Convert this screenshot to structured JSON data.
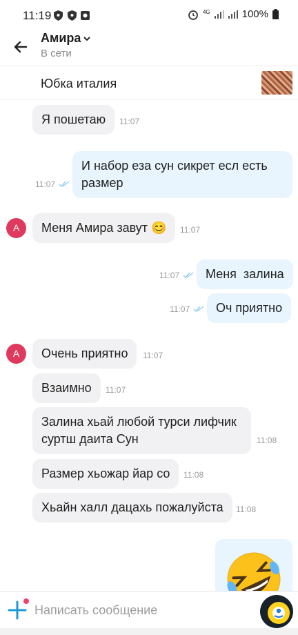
{
  "status_bar": {
    "time": "11:19",
    "network": "4G",
    "battery": "100%"
  },
  "header": {
    "contact_name": "Амира",
    "presence": "В сети"
  },
  "pinned_item": {
    "title": "Юбка италия"
  },
  "messages": [
    {
      "direction": "in",
      "text": "Я пошетаю",
      "time": "11:07"
    },
    {
      "direction": "out",
      "text": "И набор еза сун сикрет есл есть размер",
      "time": "11:07"
    },
    {
      "direction": "in",
      "avatar_letter": "А",
      "text": "Меня Амира завут 😊",
      "time": "11:07"
    },
    {
      "direction": "out",
      "text": "Меня  залина",
      "time": "11:07"
    },
    {
      "direction": "out",
      "text": "Оч приятно",
      "time": "11:07"
    },
    {
      "direction": "in",
      "avatar_letter": "А",
      "text": "Очень приятно",
      "time": "11:07"
    },
    {
      "direction": "in",
      "text": "Взаимно",
      "time": "11:07"
    },
    {
      "direction": "in",
      "text": "Залина хьай любой турси лифчик суртш даита Сун",
      "time": "11:08"
    },
    {
      "direction": "in",
      "text": "Размер хьожар йар со",
      "time": "11:08"
    },
    {
      "direction": "in",
      "text": "Хьайн халл дацахь пожалуйста",
      "time": "11:08"
    },
    {
      "direction": "out",
      "emoji": "🤣"
    }
  ],
  "composer": {
    "placeholder": "Написать сообщение"
  },
  "colors": {
    "accent": "#1e9bd7",
    "outgoing_bubble": "#e8f5fe",
    "incoming_bubble": "#f1f1f3",
    "avatar": "#e0395e",
    "read_ticks": "#8fc9ef"
  }
}
